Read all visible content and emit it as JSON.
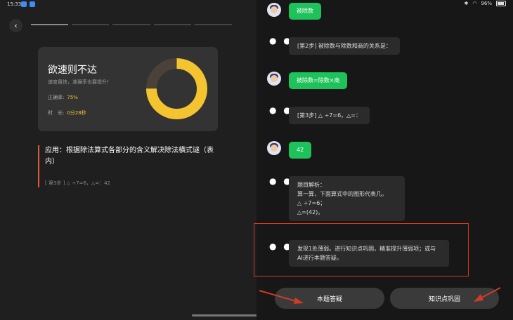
{
  "status": {
    "time": "15:33",
    "battery": "96%"
  },
  "left_panel": {
    "progress_segments": [
      true,
      false,
      false,
      false,
      false
    ],
    "result_card": {
      "title": "欲速则不达",
      "subtitle": "速度虽快，准确率也要提升！",
      "accuracy_label": "正确率:",
      "accuracy_value": "75%",
      "accuracy_fraction": 0.75,
      "duration_label": "时　长:",
      "duration_value": "0分28秒"
    },
    "application": {
      "title": "应用：根据除法算式各部分的含义解决除法横式谜（表内）",
      "step": "[ 第3步 ] △ ÷7=6，△=：42"
    }
  },
  "chat": {
    "messages": [
      {
        "role": "user",
        "text": "被除数"
      },
      {
        "role": "ai",
        "text": "[第2步] 被除数与除数和商的关系是："
      },
      {
        "role": "user",
        "text": "被除数=除数×商"
      },
      {
        "role": "ai",
        "text": "[第3步] △ ÷7=6，△=："
      },
      {
        "role": "user",
        "text": "42"
      },
      {
        "role": "ai",
        "lines": [
          "题目解析：",
          "算一算，下面算式中的图形代表几。",
          "△ ÷7=6；",
          "△=(42)。"
        ]
      },
      {
        "role": "ai",
        "text": "发现1处薄弱。进行知识点巩固，精准提升薄弱项；或与AI进行本题答疑。"
      }
    ]
  },
  "buttons": {
    "question_help": "本题答疑",
    "knowledge_review": "知识点巩固"
  },
  "colors": {
    "accent_yellow": "#f4c430",
    "user_bubble": "#1ec25a",
    "highlight": "#d13a26"
  }
}
